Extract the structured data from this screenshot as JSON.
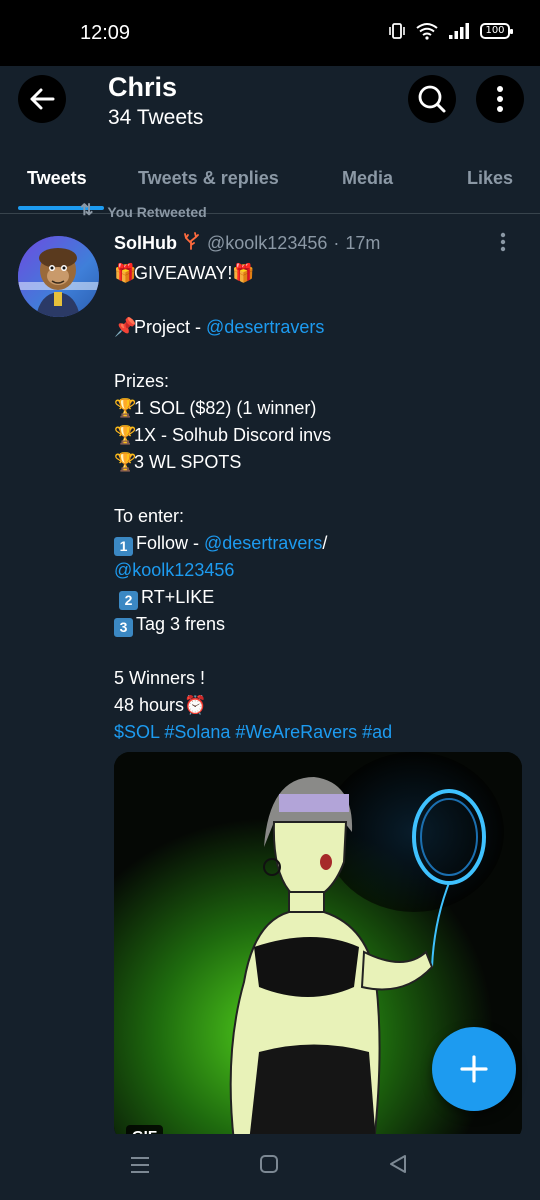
{
  "status_bar": {
    "time": "12:09",
    "battery": "100",
    "icons": [
      "vibrate-icon",
      "wifi-icon",
      "signal-icon",
      "battery-icon"
    ]
  },
  "header": {
    "name": "Chris",
    "tweet_count": "34 Tweets"
  },
  "tabs": [
    {
      "label": "Tweets",
      "active": true
    },
    {
      "label": "Tweets & replies",
      "active": false
    },
    {
      "label": "Media",
      "active": false
    },
    {
      "label": "Likes",
      "active": false
    }
  ],
  "tweet": {
    "retweet_context": "You Retweeted",
    "author_name": "SolHub",
    "author_handle": "@koolk123456",
    "separator": "·",
    "time": "17m",
    "text": {
      "l1": "GIVEAWAY!",
      "l2_prefix": "Project - ",
      "l2_link": "@desertravers",
      "prizes_heading": "Prizes:",
      "prize1": "1 SOL ($82) (1 winner)",
      "prize2": "1X - Solhub Discord invs",
      "prize3": "3 WL SPOTS",
      "enter_heading": "To enter:",
      "step1_prefix": "Follow - ",
      "step1_link": "@desertravers",
      "step1_slash": "/",
      "step1_link2": "@koolk123456",
      "step2": "RT+LIKE",
      "step3": "Tag 3 frens",
      "winners": "5 Winners !",
      "hours": "48 hours",
      "tags": "$SOL #Solana #WeAreRavers #ad"
    },
    "keycaps": [
      "1",
      "2",
      "3"
    ],
    "media_badge": "GIF"
  },
  "colors": {
    "background": "#15202b",
    "accent": "#1d9bf0",
    "secondary_text": "#8b98a5"
  }
}
